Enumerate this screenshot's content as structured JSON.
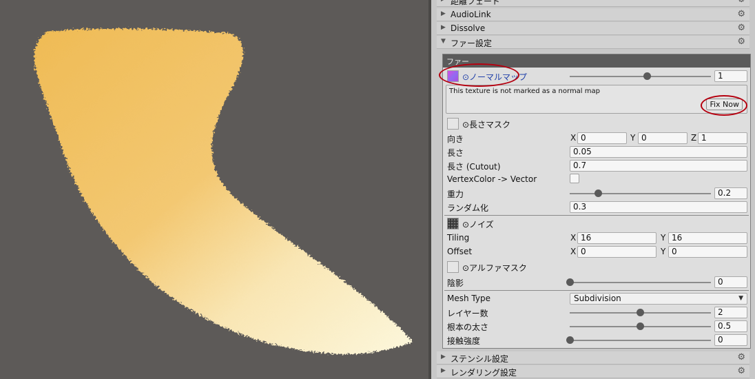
{
  "foldouts_top": [
    {
      "label": "距離フェード",
      "state": "collapsed"
    },
    {
      "label": "AudioLink",
      "state": "collapsed"
    },
    {
      "label": "Dissolve",
      "state": "collapsed"
    },
    {
      "label": "ファー設定",
      "state": "expanded"
    }
  ],
  "foldouts_bottom": [
    {
      "label": "ステンシル設定",
      "state": "collapsed"
    },
    {
      "label": "レンダリング設定",
      "state": "collapsed"
    }
  ],
  "icons": {
    "gear": "gear-icon",
    "collapsed": "triangle-right-icon",
    "expanded": "triangle-down-icon"
  },
  "fur": {
    "header": "ファー",
    "normal_map": {
      "label": "⊙ノーマルマップ",
      "value": "1",
      "slider": 0.55
    },
    "warning": {
      "text": "This texture is not marked as a normal map",
      "button": "Fix Now"
    },
    "length_mask": {
      "label": "⊙長さマスク"
    },
    "direction": {
      "label": "向き",
      "x": "0",
      "y": "0",
      "z": "1",
      "x_axis": "X",
      "y_axis": "Y",
      "z_axis": "Z"
    },
    "length": {
      "label": "長さ",
      "value": "0.05"
    },
    "length_cutout": {
      "label": "長さ (Cutout)",
      "value": "0.7"
    },
    "vertex_color": {
      "label": "VertexColor -> Vector",
      "checked": false
    },
    "gravity": {
      "label": "重力",
      "value": "0.2",
      "slider": 0.2
    },
    "randomize": {
      "label": "ランダム化",
      "value": "0.3"
    },
    "noise": {
      "label": "⊙ノイズ"
    },
    "tiling": {
      "label": "Tiling",
      "x": "16",
      "y": "16",
      "x_axis": "X",
      "y_axis": "Y"
    },
    "offset": {
      "label": "Offset",
      "x": "0",
      "y": "0",
      "x_axis": "X",
      "y_axis": "Y"
    },
    "alpha_mask": {
      "label": "⊙アルファマスク"
    },
    "shadow": {
      "label": "陰影",
      "value": "0",
      "slider": 0.0
    },
    "mesh_type": {
      "label": "Mesh Type",
      "value": "Subdivision"
    },
    "layers": {
      "label": "レイヤー数",
      "value": "2",
      "slider": 0.5
    },
    "root_width": {
      "label": "根本の太さ",
      "value": "0.5",
      "slider": 0.5
    },
    "touch_strength": {
      "label": "接触強度",
      "value": "0",
      "slider": 0.0
    }
  },
  "colors": {
    "annotation_ring": "#b5000f",
    "fur_orange": "#efbc55",
    "fur_cream": "#fbf6d8",
    "viewport_bg": "#5d5a58"
  }
}
